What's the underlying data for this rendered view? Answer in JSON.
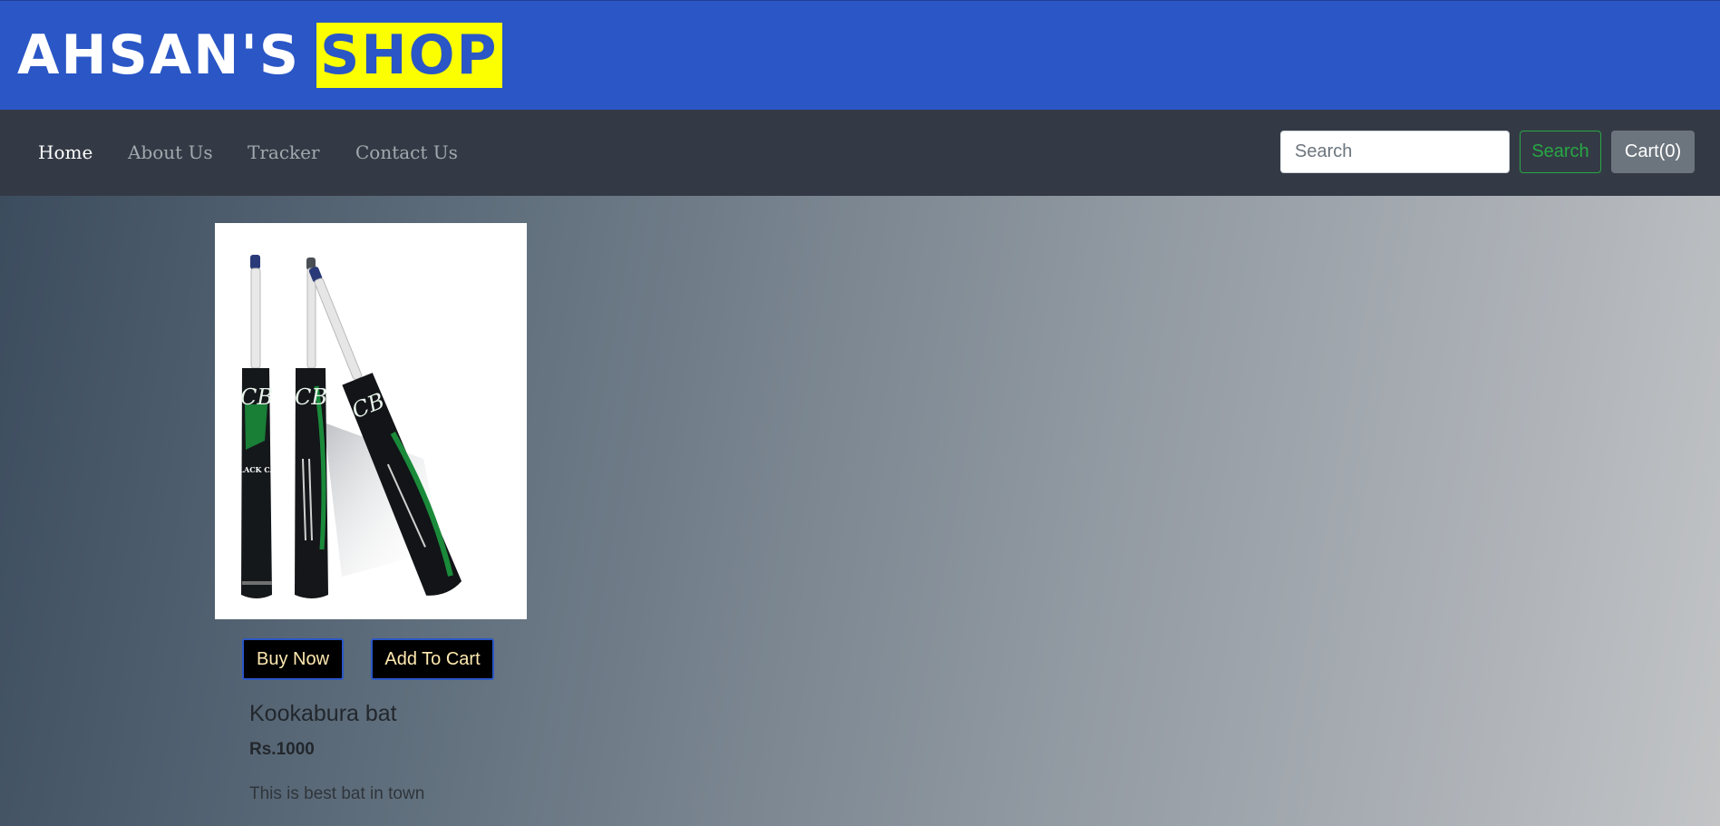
{
  "brand": {
    "name": "AHSAN'S",
    "highlight": "SHOP"
  },
  "nav": {
    "items": [
      {
        "label": "Home",
        "active": true
      },
      {
        "label": "About Us",
        "active": false
      },
      {
        "label": "Tracker",
        "active": false
      },
      {
        "label": "Contact Us",
        "active": false
      }
    ]
  },
  "search": {
    "placeholder": "Search",
    "value": "",
    "button_label": "Search"
  },
  "cart": {
    "label": "Cart(0)"
  },
  "product": {
    "name": "Kookabura bat",
    "price": "Rs.1000",
    "description": "This is best bat in town",
    "image_alt": "Black Cat cricket bats",
    "image_logo_text": "CB",
    "image_brand_text": "BLACK CAT",
    "buy_label": "Buy Now",
    "cart_label": "Add To Cart"
  },
  "colors": {
    "brand_bar": "#2a56c6",
    "highlight": "#fbff00",
    "navbar": "#343a45",
    "search_button": "#28a745",
    "cart_button": "#6c757d"
  }
}
